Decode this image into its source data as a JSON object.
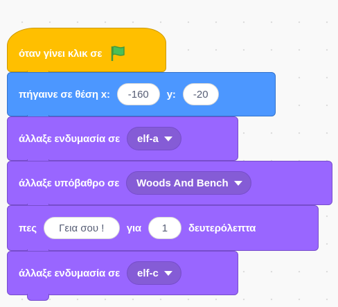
{
  "colors": {
    "events": "#ffbf00",
    "motion": "#4c97ff",
    "looks": "#9966ff",
    "dropdown": "#855cd6",
    "flag": "#4cbf56"
  },
  "script": {
    "hat": {
      "label": "όταν γίνει κλικ σε",
      "icon": "green-flag-icon"
    },
    "goto": {
      "label": "πήγαινε σε θέση x:",
      "x_value": "-160",
      "y_label": "y:",
      "y_value": "-20"
    },
    "costume1": {
      "label": "άλλαξε ενδυμασία σε",
      "value": "elf-a"
    },
    "backdrop": {
      "label": "άλλαξε υπόβαθρο σε",
      "value": "Woods And Bench"
    },
    "say": {
      "label": "πες",
      "message": "Γεια σου !",
      "for_label": "για",
      "seconds": "1",
      "seconds_label": "δευτερόλεπτα"
    },
    "costume2": {
      "label": "άλλαξε ενδυμασία σε",
      "value": "elf-c"
    }
  }
}
